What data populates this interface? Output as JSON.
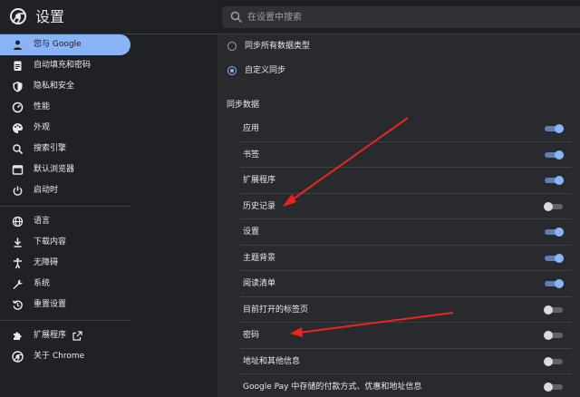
{
  "header": {
    "title": "设置",
    "search_placeholder": "在设置中搜索"
  },
  "sidebar": {
    "items": [
      {
        "label": "您与 Google",
        "icon": "person-icon",
        "active": true
      },
      {
        "label": "自动填充和密码",
        "icon": "clipboard-icon"
      },
      {
        "label": "隐私和安全",
        "icon": "shield-icon"
      },
      {
        "label": "性能",
        "icon": "speedometer-icon"
      },
      {
        "label": "外观",
        "icon": "palette-icon"
      },
      {
        "label": "搜索引擎",
        "icon": "search-icon"
      },
      {
        "label": "默认浏览器",
        "icon": "browser-icon"
      },
      {
        "label": "启动时",
        "icon": "power-icon"
      }
    ],
    "items2": [
      {
        "label": "语言",
        "icon": "globe-icon"
      },
      {
        "label": "下载内容",
        "icon": "download-icon"
      },
      {
        "label": "无障碍",
        "icon": "accessibility-icon"
      },
      {
        "label": "系统",
        "icon": "wrench-icon"
      },
      {
        "label": "重置设置",
        "icon": "reset-icon"
      }
    ],
    "items3": [
      {
        "label": "扩展程序",
        "icon": "puzzle-icon",
        "external_icon": "open-in-new-icon"
      },
      {
        "label": "关于 Chrome",
        "icon": "chrome-icon"
      }
    ]
  },
  "main": {
    "radio_options": [
      {
        "label": "同步所有数据类型",
        "checked": false
      },
      {
        "label": "自定义同步",
        "checked": true
      }
    ],
    "section_title": "同步数据",
    "sync_items": [
      {
        "label": "应用",
        "enabled": true
      },
      {
        "label": "书签",
        "enabled": true
      },
      {
        "label": "扩展程序",
        "enabled": true
      },
      {
        "label": "历史记录",
        "enabled": false
      },
      {
        "label": "设置",
        "enabled": true
      },
      {
        "label": "主题背景",
        "enabled": true
      },
      {
        "label": "阅读清单",
        "enabled": true
      },
      {
        "label": "目前打开的标签页",
        "enabled": false
      },
      {
        "label": "密码",
        "enabled": false
      },
      {
        "label": "地址和其他信息",
        "enabled": false
      },
      {
        "label": "Google Pay 中存储的付款方式、优惠和地址信息",
        "enabled": false
      }
    ]
  },
  "colors": {
    "background": "#202124",
    "card": "#292a2d",
    "accent": "#8ab4f8",
    "arrow": "#e8261e"
  }
}
